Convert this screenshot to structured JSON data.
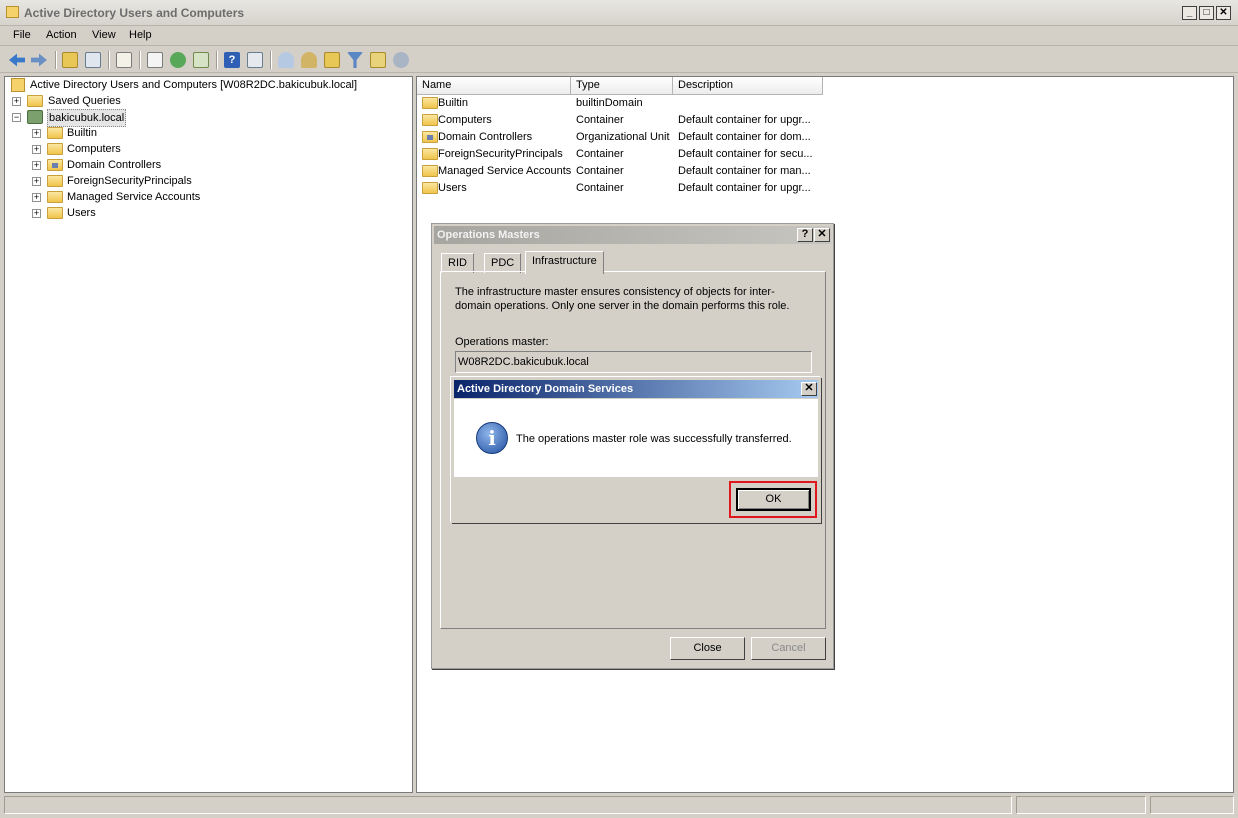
{
  "window": {
    "title": "Active Directory Users and Computers",
    "controls": {
      "minimize": "_",
      "maximize": "□",
      "close": "✕"
    }
  },
  "menu": [
    "File",
    "Action",
    "View",
    "Help"
  ],
  "toolbar": {
    "icons": [
      "back-arrow-icon",
      "forward-arrow-icon",
      "up-folder-icon",
      "console-tree-icon",
      "properties-icon",
      "refresh-icon",
      "export-list-icon",
      "help-icon",
      "show-hide-icon",
      "new-user-icon",
      "new-group-icon",
      "new-ou-icon",
      "filter-icon",
      "find-icon",
      "add-to-group-icon"
    ]
  },
  "tree": {
    "root": "Active Directory Users and Computers [W08R2DC.bakicubuk.local]",
    "saved_queries": "Saved Queries",
    "domain": "bakicubuk.local",
    "children": [
      "Builtin",
      "Computers",
      "Domain Controllers",
      "ForeignSecurityPrincipals",
      "Managed Service Accounts",
      "Users"
    ]
  },
  "list": {
    "columns": [
      "Name",
      "Type",
      "Description"
    ],
    "rows": [
      {
        "name": "Builtin",
        "type": "builtinDomain",
        "description": ""
      },
      {
        "name": "Computers",
        "type": "Container",
        "description": "Default container for upgr..."
      },
      {
        "name": "Domain Controllers",
        "type": "Organizational Unit",
        "description": "Default container for dom..."
      },
      {
        "name": "ForeignSecurityPrincipals",
        "type": "Container",
        "description": "Default container for secu..."
      },
      {
        "name": "Managed Service Accounts",
        "type": "Container",
        "description": "Default container for man..."
      },
      {
        "name": "Users",
        "type": "Container",
        "description": "Default container for upgr..."
      }
    ]
  },
  "dialog": {
    "title": "Operations Masters",
    "help_btn": "?",
    "close_btn": "✕",
    "tabs": [
      "RID",
      "PDC",
      "Infrastructure"
    ],
    "active_tab": "Infrastructure",
    "description": "The infrastructure master ensures consistency of objects for inter-domain operations. Only one server in the domain performs this role.",
    "om_label": "Operations master:",
    "om_value": "W08R2DC.bakicubuk.local",
    "close_label": "Close",
    "cancel_label": "Cancel"
  },
  "message": {
    "title": "Active Directory Domain Services",
    "close_btn": "✕",
    "icon": "i",
    "text": "The operations master role was successfully transferred.",
    "ok_label": "OK",
    "highlight_color": "#e0161c"
  }
}
